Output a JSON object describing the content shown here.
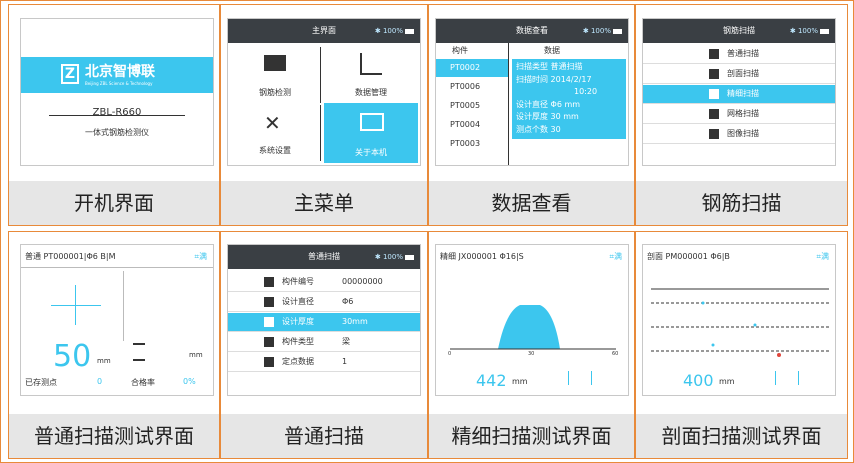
{
  "captions": [
    "开机界面",
    "主菜单",
    "数据查看",
    "钢筋扫描",
    "普通扫描测试界面",
    "普通扫描",
    "精细扫描测试界面",
    "剖面扫描测试界面"
  ],
  "status": {
    "bt": "✱ 100%"
  },
  "boot": {
    "brand": "北京智博联",
    "brand_sub": "Beijing ZBL Science & Technology",
    "model": "ZBL-R660",
    "desc": "一体式钢筋检测仪"
  },
  "menu": {
    "title": "主界面",
    "items": [
      "钢筋检测",
      "数据管理",
      "系统设置",
      "关于本机"
    ]
  },
  "dataview": {
    "title": "数据查看",
    "col1": "构件",
    "col2": "数据",
    "ids": [
      "PT0002",
      "PT0006",
      "PT0005",
      "PT0004",
      "PT0003"
    ],
    "details": [
      "扫描类型  普通扫描",
      "扫描时间  2014/2/17",
      "10:20",
      "设计直径  Φ6 mm",
      "设计厚度  30 mm",
      "测点个数  30"
    ]
  },
  "rebar": {
    "title": "钢筋扫描",
    "items": [
      "普通扫描",
      "剖面扫描",
      "精细扫描",
      "网格扫描",
      "图像扫描"
    ]
  },
  "normaltest": {
    "header": "普通  PT000001|Φ6 B|M",
    "conn": "⌗满",
    "value": "50",
    "unit": "mm",
    "count_label": "已存测点",
    "count": "0",
    "pass_label": "合格率",
    "pass": "0%",
    "unit_right": "mm"
  },
  "normal": {
    "title": "普通扫描",
    "rows": [
      {
        "label": "构件编号",
        "value": "00000000"
      },
      {
        "label": "设计直径",
        "value": "Φ6"
      },
      {
        "label": "设计厚度",
        "value": "30mm"
      },
      {
        "label": "构件类型",
        "value": "梁"
      },
      {
        "label": "定点数据",
        "value": "1"
      }
    ]
  },
  "finetest": {
    "header": "精细  JX000001  Φ16|S",
    "conn": "⌗满",
    "value": "442",
    "unit": "mm",
    "axis": [
      "0",
      "30",
      "60"
    ]
  },
  "profiletest": {
    "header": "剖面  PM000001  Φ6|B",
    "conn": "⌗满",
    "value": "400",
    "unit": "mm"
  }
}
